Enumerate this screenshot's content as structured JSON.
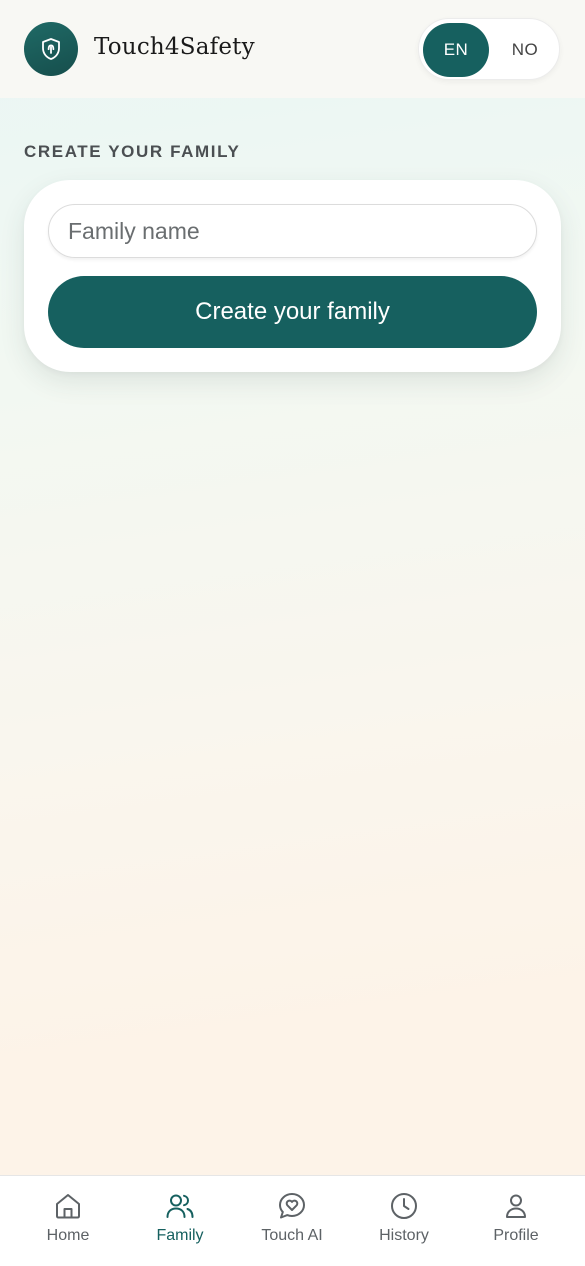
{
  "header": {
    "brand": "Touch4Safety",
    "logo_icon": "shield-touch-icon",
    "languages": [
      {
        "label": "EN",
        "active": true
      },
      {
        "label": "NO",
        "active": false
      }
    ]
  },
  "section": {
    "title": "CREATE YOUR FAMILY"
  },
  "form": {
    "family_name_placeholder": "Family name",
    "family_name_value": "",
    "submit_label": "Create your family"
  },
  "bottom_nav": {
    "items": [
      {
        "label": "Home",
        "icon": "home-icon",
        "active": false
      },
      {
        "label": "Family",
        "icon": "family-icon",
        "active": true
      },
      {
        "label": "Touch AI",
        "icon": "chat-heart-icon",
        "active": false
      },
      {
        "label": "History",
        "icon": "clock-icon",
        "active": false
      },
      {
        "label": "Profile",
        "icon": "user-icon",
        "active": false
      }
    ]
  },
  "colors": {
    "accent": "#16605f",
    "nav_inactive": "#5d6266",
    "text_muted": "#4b4f52"
  }
}
